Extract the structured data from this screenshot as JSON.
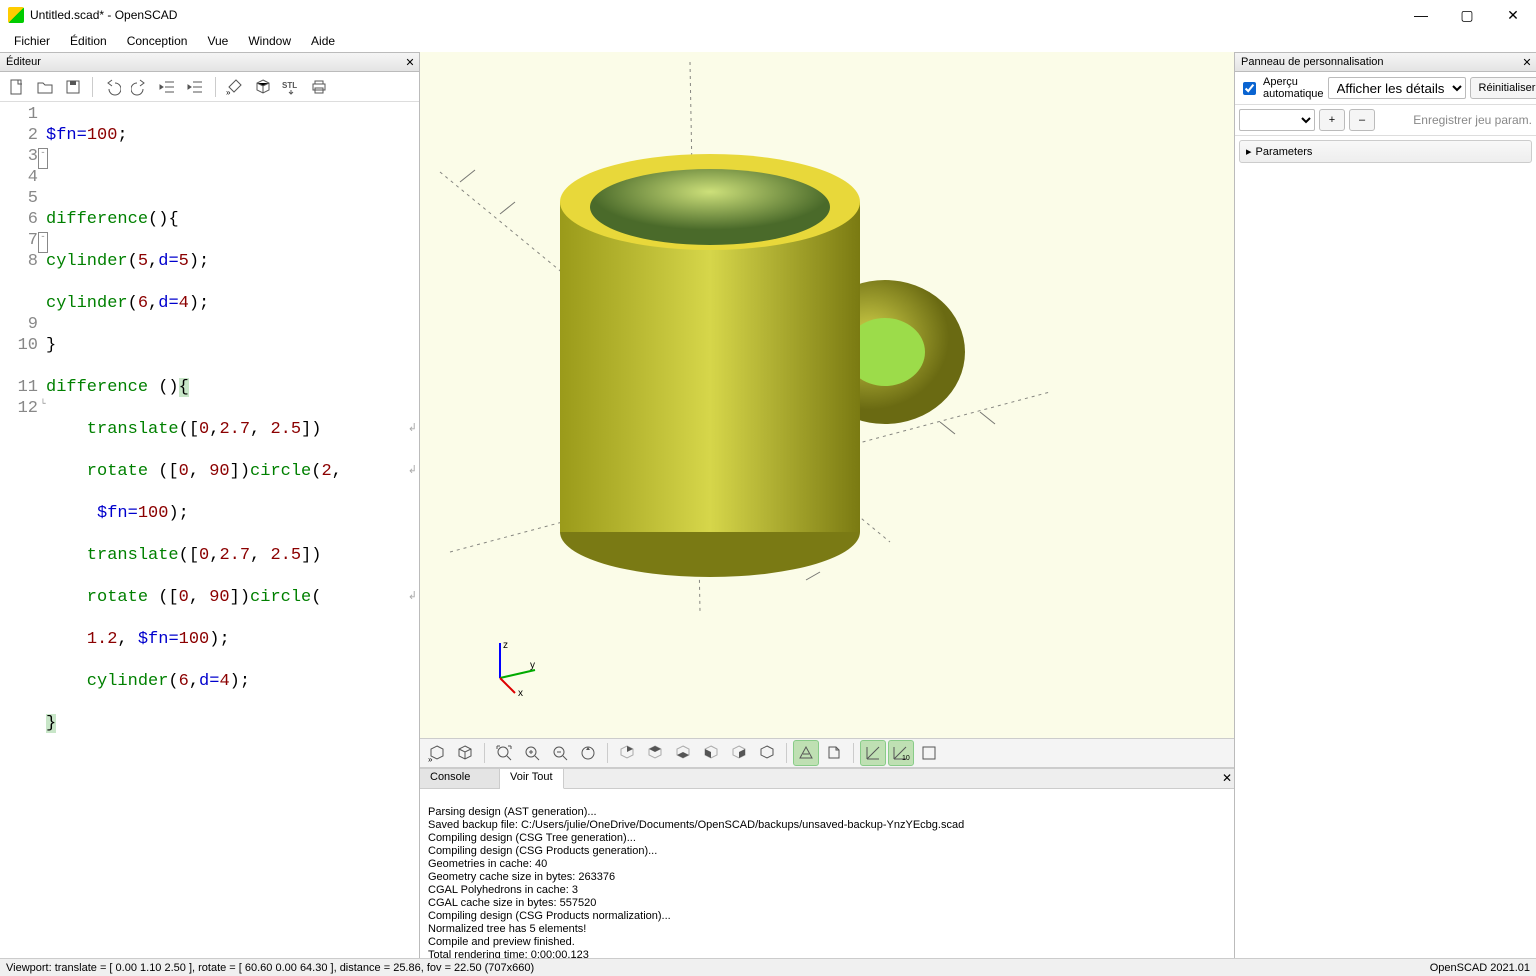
{
  "title": "Untitled.scad* - OpenSCAD",
  "menu": [
    "Fichier",
    "Édition",
    "Conception",
    "Vue",
    "Window",
    "Aide"
  ],
  "panes": {
    "editor": "Éditeur",
    "custom": "Panneau de personnalisation",
    "console": "Console",
    "voirtout": "Voir Tout"
  },
  "editor_toolbar": {
    "new": "new-file-icon",
    "open": "open-file-icon",
    "save": "save-file-icon",
    "undo": "undo-icon",
    "redo": "redo-icon",
    "unindent": "unindent-icon",
    "indent": "indent-icon",
    "preview": "preview-icon",
    "render": "render-icon",
    "stl": "export-stl-icon",
    "print": "print-icon"
  },
  "code": {
    "l1": {
      "a": "$fn",
      "b": "=",
      "c": "100",
      "d": ";"
    },
    "l3": {
      "a": "difference",
      "b": "()",
      "c": "{"
    },
    "l4": {
      "a": "cylinder",
      "b": "(",
      "c": "5",
      "d": ",",
      "e": "d",
      "f": "=",
      "g": "5",
      "h": ");"
    },
    "l5": {
      "a": "cylinder",
      "b": "(",
      "c": "6",
      "d": ",",
      "e": "d",
      "f": "=",
      "g": "4",
      "h": ");"
    },
    "l6": {
      "a": "}"
    },
    "l7": {
      "a": "difference ",
      "b": "()",
      "c": "{"
    },
    "l8a": {
      "a": "    translate",
      "b": "([",
      "c": "0",
      "d": ",",
      "e": "2.7",
      "f": ", ",
      "g": "2.5",
      "h": "])"
    },
    "l8b": {
      "a": "    rotate ",
      "b": "([",
      "c": "0",
      "d": ", ",
      "e": "90",
      "f": "])",
      "g": "circle",
      "h": "(",
      "i": "2",
      "j": ","
    },
    "l8c": {
      "a": "     ",
      "b": "$fn",
      "c": "=",
      "d": "100",
      "e": ");"
    },
    "l9": {
      "a": "    translate",
      "b": "([",
      "c": "0",
      "d": ",",
      "e": "2.7",
      "f": ", ",
      "g": "2.5",
      "h": "])"
    },
    "l10a": {
      "a": "    rotate ",
      "b": "([",
      "c": "0",
      "d": ", ",
      "e": "90",
      "f": "])",
      "g": "circle",
      "h": "("
    },
    "l10b": {
      "a": "    ",
      "b": "1.2",
      "c": ", ",
      "d": "$fn",
      "e": "=",
      "f": "100",
      "g": ");"
    },
    "l11": {
      "a": "    cylinder",
      "b": "(",
      "c": "6",
      "d": ",",
      "e": "d",
      "f": "=",
      "g": "4",
      "h": ");"
    },
    "l12": {
      "a": "}"
    }
  },
  "line_numbers": [
    "1",
    "2",
    "3",
    "4",
    "5",
    "6",
    "7",
    "8",
    "",
    "",
    "9",
    "10",
    "",
    "11",
    "12"
  ],
  "viewport_toolbar": [
    "preview",
    "render-wire",
    "zoom-reset",
    "zoom-in",
    "zoom-out",
    "rotate",
    "view-left",
    "view-right",
    "view-front",
    "view-back",
    "view-top",
    "view-bottom",
    "perspective",
    "ortho",
    "axes",
    "scalemarkers",
    "crosshair"
  ],
  "console_lines": [
    "Parsing design (AST generation)...",
    "Saved backup file: C:/Users/julie/OneDrive/Documents/OpenSCAD/backups/unsaved-backup-YnzYEcbg.scad",
    "Compiling design (CSG Tree generation)...",
    "Compiling design (CSG Products generation)...",
    "Geometries in cache: 40",
    "Geometry cache size in bytes: 263376",
    "CGAL Polyhedrons in cache: 3",
    "CGAL cache size in bytes: 557520",
    "Compiling design (CSG Products normalization)...",
    "Normalized tree has 5 elements!",
    "Compile and preview finished.",
    "Total rendering time: 0:00:00.123"
  ],
  "right": {
    "auto": "Aperçu automatique",
    "details": "Afficher les détails",
    "reset": "Réinitialiser",
    "plus": "+",
    "minus": "–",
    "save_placeholder": "Enregistrer jeu param.",
    "params": "Parameters"
  },
  "status": {
    "left": "Viewport: translate = [ 0.00 1.10 2.50 ], rotate = [ 60.60 0.00 64.30 ], distance = 25.86, fov = 22.50 (707x660)",
    "right": "OpenSCAD 2021.01"
  },
  "axes": {
    "x": "x",
    "y": "y",
    "z": "z"
  }
}
